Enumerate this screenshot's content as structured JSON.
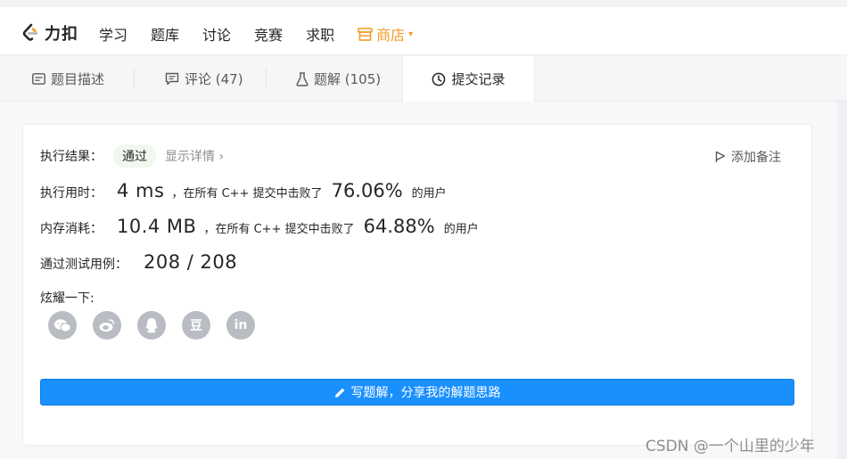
{
  "app": {
    "brand": "力扣"
  },
  "nav": {
    "items": [
      "学习",
      "题库",
      "讨论",
      "竞赛",
      "求职"
    ],
    "store": "商店"
  },
  "tabs": [
    {
      "label": "题目描述",
      "icon": "description-icon"
    },
    {
      "label": "评论 (47)",
      "icon": "comment-icon"
    },
    {
      "label": "题解 (105)",
      "icon": "flask-icon"
    },
    {
      "label": "提交记录",
      "icon": "clock-icon",
      "active": true
    }
  ],
  "result": {
    "label": "执行结果：",
    "status": "通过",
    "detail": "显示详情 ›",
    "note": "添加备注"
  },
  "runtime": {
    "label": "执行用时：",
    "value": "4 ms",
    "prefix": "，在所有 C++ 提交中击败了",
    "percent": "76.06%",
    "suffix": "的用户"
  },
  "memory": {
    "label": "内存消耗：",
    "value": "10.4 MB",
    "prefix": "，在所有 C++ 提交中击败了",
    "percent": "64.88%",
    "suffix": "的用户"
  },
  "tests": {
    "label": "通过测试用例：",
    "value": "208 / 208"
  },
  "share": {
    "label": "炫耀一下:",
    "items": [
      "wechat-icon",
      "weibo-icon",
      "qq-icon",
      "douban-icon",
      "linkedin-icon"
    ],
    "douban_glyph": "豆",
    "linkedin_glyph": "in"
  },
  "button": {
    "label": "写题解，分享我的解题思路"
  },
  "watermark": "CSDN @一个山里的少年",
  "colors": {
    "accent": "#1a90ff",
    "store": "#f49a25",
    "pass_bg": "#f1f8ef"
  }
}
